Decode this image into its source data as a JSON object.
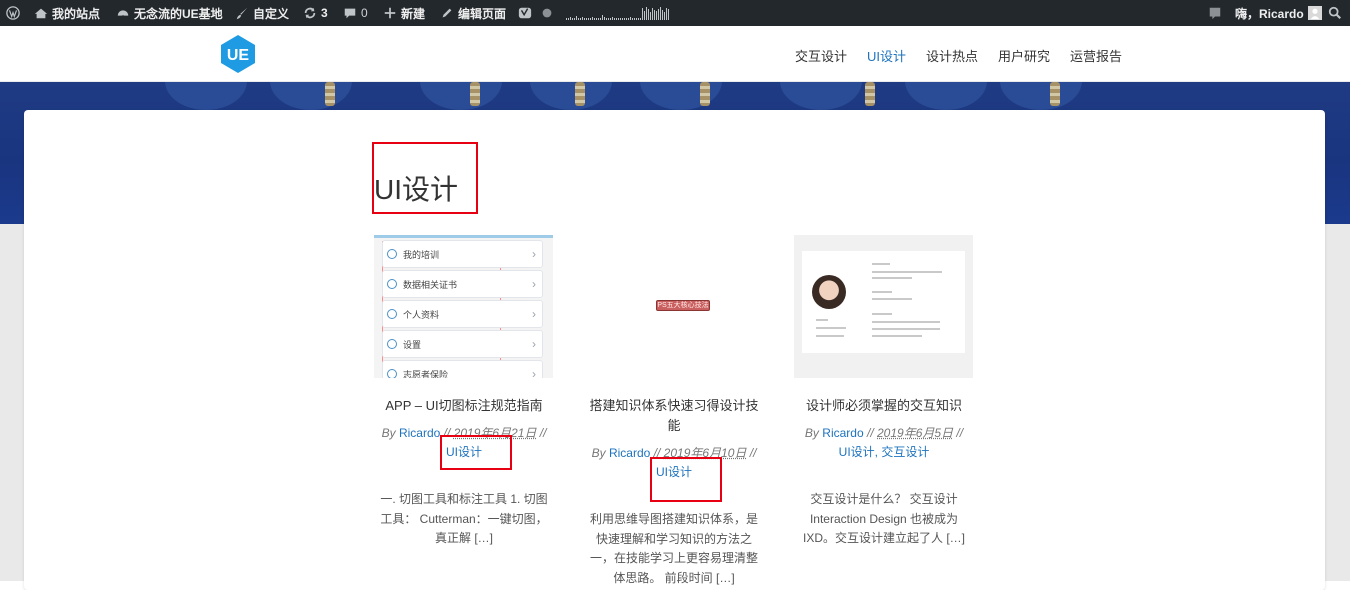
{
  "adminbar": {
    "my_sites": "我的站点",
    "site_name": "无念流的UE基地",
    "customize": "自定义",
    "updates": "3",
    "comments": "0",
    "new": "新建",
    "edit_page": "编辑页面",
    "greeting": "嗨，Ricardo"
  },
  "header": {
    "logo_text": "UE",
    "nav": [
      {
        "label": "交互设计"
      },
      {
        "label": "UI设计"
      },
      {
        "label": "设计热点"
      },
      {
        "label": "用户研究"
      },
      {
        "label": "运营报告"
      }
    ],
    "accent": "#1e73be"
  },
  "archive": {
    "title": "UI设计"
  },
  "posts": [
    {
      "title": "APP – UI切图标注规范指南",
      "by": "By",
      "author": "Ricardo",
      "date": "2019年6月21日",
      "categories": "UI设计",
      "excerpt": "一. 切图工具和标注工具 1. 切图工具： Cutterman：一键切图，真正解 […]",
      "thumb_rows": [
        "我的培训",
        "数据相关证书",
        "个人资料",
        "设置",
        "志愿者保险"
      ]
    },
    {
      "title": "搭建知识体系快速习得设计技能",
      "by": "By",
      "author": "Ricardo",
      "date": "2019年6月10日",
      "categories": "UI设计",
      "excerpt": "利用思维导图搭建知识体系，是快速理解和学习知识的方法之一，在技能学习上更容易理清整体思路。 前段时间 […]",
      "thumb_label": "PS五大核心技法"
    },
    {
      "title": "设计师必须掌握的交互知识",
      "by": "By",
      "author": "Ricardo",
      "date": "2019年6月5日",
      "categories": "UI设计, 交互设计",
      "excerpt": "交互设计是什么？ 交互设计 Interaction Design 也被成为IXD。交互设计建立起了人 […]"
    }
  ]
}
